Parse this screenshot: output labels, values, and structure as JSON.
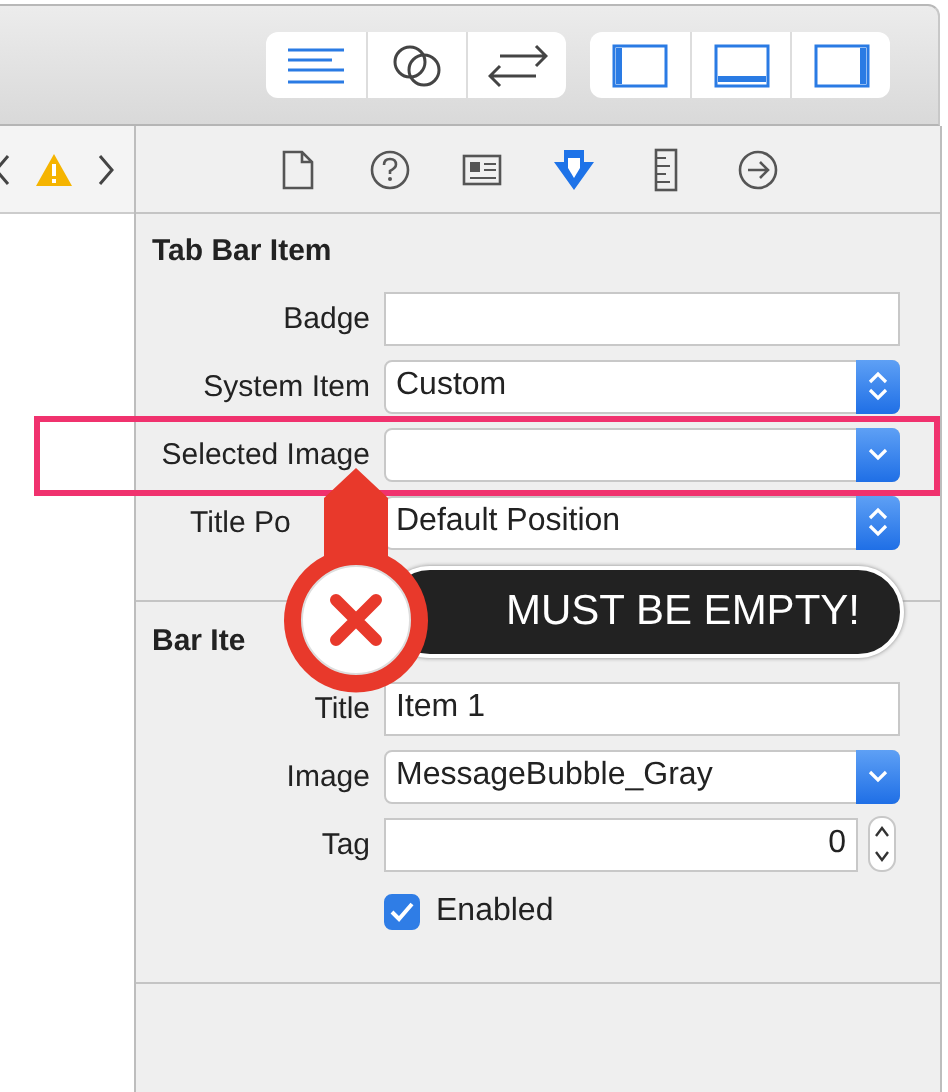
{
  "toolbar": {
    "groups": [
      {
        "buttons": [
          {
            "selected": false
          },
          {
            "selected": false
          },
          {
            "selected": false
          }
        ]
      },
      {
        "buttons": [
          {
            "selected": false
          },
          {
            "selected": false
          },
          {
            "selected": false
          }
        ]
      }
    ]
  },
  "inspector_tabs": [
    {
      "selected": false
    },
    {
      "selected": false
    },
    {
      "selected": false
    },
    {
      "selected": true
    },
    {
      "selected": false
    },
    {
      "selected": false
    }
  ],
  "sections": [
    {
      "title": "Tab Bar Item",
      "rows": [
        {
          "kind": "text",
          "label": "Badge",
          "value": "",
          "highlighted": false
        },
        {
          "kind": "popup",
          "label": "System Item",
          "value": "Custom",
          "highlighted": false
        },
        {
          "kind": "combo",
          "label": "Selected Image",
          "value": "",
          "highlighted": true
        },
        {
          "kind": "popup",
          "label": "Title Po",
          "value": "Default Position",
          "highlighted": false,
          "covered": true
        }
      ]
    },
    {
      "title": "Bar Ite",
      "rows": [
        {
          "kind": "text",
          "label": "Title",
          "value": "Item 1",
          "highlighted": false
        },
        {
          "kind": "combo",
          "label": "Image",
          "value": "MessageBubble_Gray",
          "highlighted": false
        },
        {
          "kind": "stepper",
          "label": "Tag",
          "value": "0",
          "highlighted": false
        },
        {
          "kind": "checkbox",
          "label": "Enabled",
          "checked": true,
          "highlighted": false
        }
      ]
    }
  ],
  "callout": {
    "text": "MUST BE EMPTY!"
  }
}
